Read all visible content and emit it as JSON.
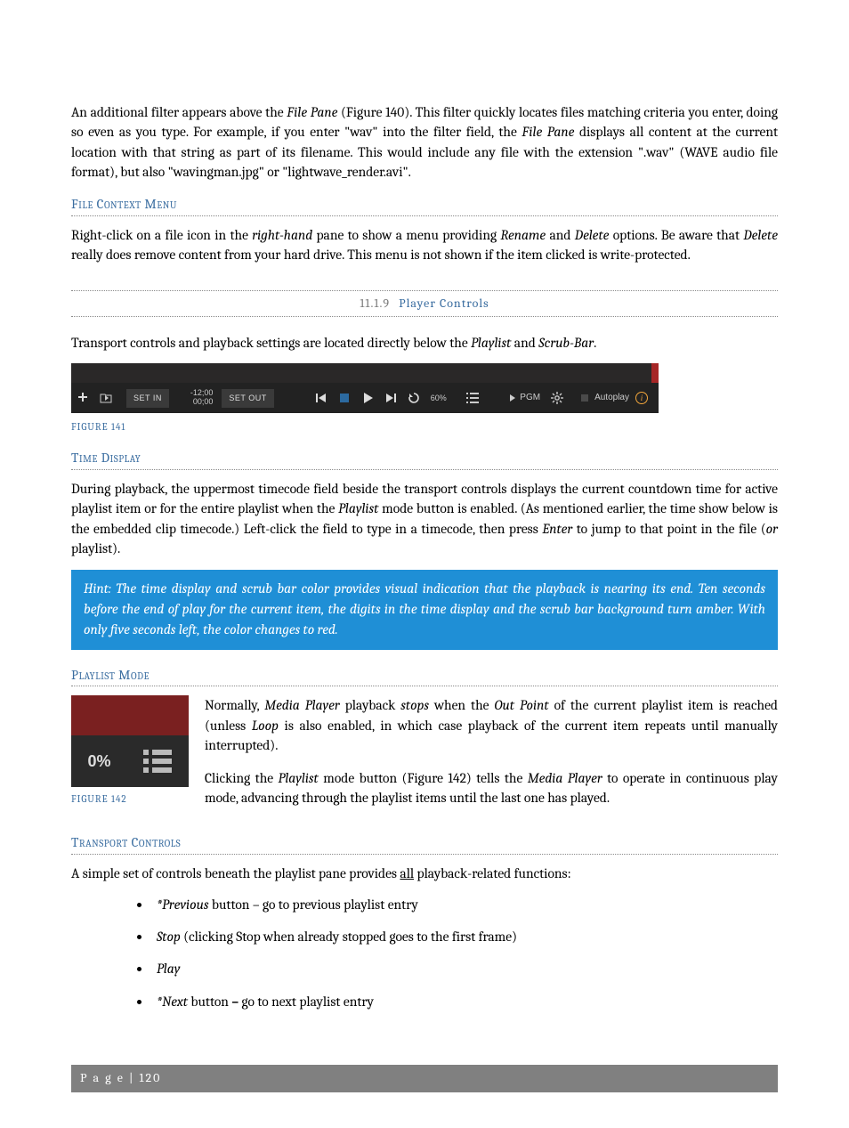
{
  "intro": {
    "p1a": "An additional filter appears above the ",
    "p1b": "File Pane",
    "p1c": " (Figure 140).  This filter quickly locates files matching criteria you enter, doing so even as you type.  For example, if you enter \"wav\" into the filter field, the ",
    "p1d": "File Pane",
    "p1e": " displays all content at the current location with that string as part of its filename.  This would include any file with the extension \".wav\" (WAVE audio file format), but also \"wavingman.jpg\" or \"lightwave_render.avi\"."
  },
  "heading_file_context": "File Context Menu",
  "file_context": {
    "a": "Right-click on a file icon in the ",
    "b": "right-hand",
    "c": " pane to show a menu providing ",
    "d": "Rename",
    "e": " and ",
    "f": "Delete",
    "g": " options.  Be aware that ",
    "h": "Delete",
    "i": " really does remove content from your hard drive.  This menu is not shown if the item clicked is write-protected."
  },
  "section": {
    "num": "11.1.9",
    "title": "Player Controls"
  },
  "transport_intro": {
    "a": "Transport controls and playback settings are located directly below the ",
    "b": "Playlist",
    "c": " and ",
    "d": "Scrub-Bar",
    "e": "."
  },
  "fig141": {
    "caption": "FIGURE 141",
    "set_in": "SET IN",
    "time_top": "-12;00",
    "time_bot": "00;00",
    "set_out": "SET OUT",
    "speed": "60%",
    "pgm": "PGM",
    "autoplay": "Autoplay"
  },
  "heading_time": "Time Display",
  "time_para": {
    "a": "During playback, the uppermost timecode field beside the transport controls displays the current countdown time for active playlist item or for the entire playlist when the ",
    "b": "Playlist",
    "c": " mode button is enabled.  (As mentioned earlier, the time show below is the embedded clip timecode.)  Left-click the field to type in a timecode, then press ",
    "d": "Enter",
    "e": " to jump to that point in the file (",
    "f": "or",
    "g": " playlist)."
  },
  "hint": "Hint: The time display and scrub bar color provides visual indication that the playback is nearing its end.  Ten seconds before the end of play for the current item, the digits in the time display and the scrub bar background turn amber.   With only five seconds left, the color changes to red.",
  "heading_playlist": "Playlist Mode",
  "fig142": {
    "pct": "0%",
    "caption": "FIGURE 142"
  },
  "playlist_p1": {
    "a": "Normally, ",
    "b": "Media Player",
    "c": " playback ",
    "d": "stops",
    "e": " when the ",
    "f": "Out Point",
    "g": " of the current playlist item is reached (unless ",
    "h": "Loop",
    "i": " is also enabled, in which case playback of the current item repeats until manually interrupted)."
  },
  "playlist_p2": {
    "a": "Clicking the ",
    "b": "Playlist",
    "c": " mode button (Figure 142) tells the ",
    "d": "Media Player",
    "e": " to operate in continuous play mode, advancing through the playlist items until the last one has played."
  },
  "heading_tc": "Transport Controls",
  "tc_intro": {
    "a": "A simple set of controls beneath the playlist pane provides ",
    "b": "all",
    "c": " playback-related functions:"
  },
  "bullets": {
    "b1a": "*Previous",
    "b1b": " button – go to previous playlist entry",
    "b2a": "Stop",
    "b2b": " (clicking Stop when already stopped goes to the first frame)",
    "b3": "Play",
    "b4a": "*Next",
    "b4b": " button ",
    "b4c": "–",
    "b4d": " go to next playlist entry"
  },
  "footer": "P a g e  | 120"
}
